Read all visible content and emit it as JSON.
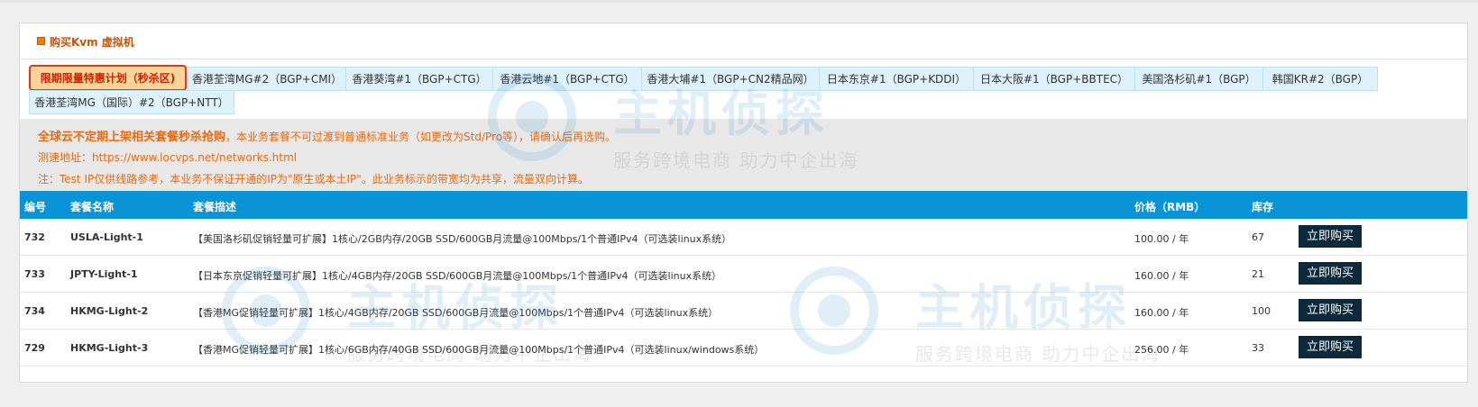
{
  "panel": {
    "title": "购买Kvm 虚拟机"
  },
  "tabs": [
    "限期限量特惠计划（秒杀区)",
    "香港荃湾MG#2（BGP+CMI）",
    "香港葵湾#1（BGP+CTG）",
    "香港云地#1（BGP+CTG）",
    "香港大埔#1（BGP+CN2精品网）",
    "日本东京#1（BGP+KDDI）",
    "日本大阪#1（BGP+BBTEC）",
    "美国洛杉矶#1（BGP）",
    "韩国KR#2（BGP）",
    "香港荃湾MG（国际）#2（BGP+NTT）"
  ],
  "notice": {
    "highlight": "全球云不定期上架相关套餐秒杀抢购",
    "line1_rest": "，本业务套餐不可过渡到普通标准业务（如更改为Std/Pro等），请确认后再选购。",
    "line2": "测速地址：https://www.locvps.net/networks.html",
    "line3": "注：Test IP仅供线路参考，本业务不保证开通的IP为\"原生或本土IP\"。此业务标示的带宽均为共享，流量双向计算。"
  },
  "table": {
    "headers": {
      "id": "编号",
      "name": "套餐名称",
      "desc": "套餐描述",
      "price": "价格（RMB）",
      "stock": "库存"
    },
    "rows": [
      {
        "id": "732",
        "name": "USLA-Light-1",
        "desc": "【美国洛杉矶促销轻量可扩展】1核心/2GB内存/20GB SSD/600GB月流量@100Mbps/1个普通IPv4（可选装linux系统）",
        "price": "100.00 / 年",
        "stock": "67",
        "buy": "立即购买"
      },
      {
        "id": "733",
        "name": "JPTY-Light-1",
        "desc": "【日本东京促销轻量可扩展】1核心/4GB内存/20GB SSD/600GB月流量@100Mbps/1个普通IPv4（可选装linux系统）",
        "price": "160.00 / 年",
        "stock": "21",
        "buy": "立即购买"
      },
      {
        "id": "734",
        "name": "HKMG-Light-2",
        "desc": "【香港MG促销轻量可扩展】1核心/4GB内存/20GB SSD/600GB月流量@100Mbps/1个普通IPv4（可选装linux系统）",
        "price": "160.00 / 年",
        "stock": "100",
        "buy": "立即购买"
      },
      {
        "id": "729",
        "name": "HKMG-Light-3",
        "desc": "【香港MG促销轻量可扩展】1核心/6GB内存/40GB SSD/600GB月流量@100Mbps/1个普通IPv4（可选装linux/windows系统）",
        "price": "256.00 / 年",
        "stock": "33",
        "buy": "立即购买"
      }
    ]
  },
  "watermark": {
    "title": "主机侦探",
    "slogan": "服务跨境电商 助力中企出海"
  }
}
